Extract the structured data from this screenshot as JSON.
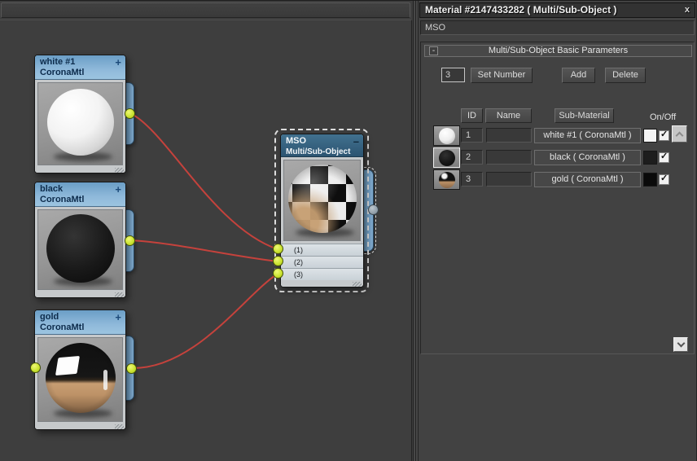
{
  "panel": {
    "title": "Material #2147433282 ( Multi/Sub-Object )",
    "close_glyph": "x",
    "material_name": "MSO"
  },
  "rollout": {
    "collapse_glyph": "-",
    "title": "Multi/Sub-Object Basic Parameters",
    "count_value": "3",
    "set_number_label": "Set Number",
    "add_label": "Add",
    "delete_label": "Delete"
  },
  "table": {
    "headers": {
      "id": "ID",
      "name": "Name",
      "sub_material": "Sub-Material",
      "on_off": "On/Off"
    },
    "check_glyph": "✓",
    "rows": [
      {
        "id": "1",
        "name": "",
        "sub_material": "white #1 ( CoronaMtl )",
        "swatch": "#f4f4f4",
        "on": true
      },
      {
        "id": "2",
        "name": "",
        "sub_material": "black ( CoronaMtl )",
        "swatch": "#1d1d1d",
        "on": true
      },
      {
        "id": "3",
        "name": "",
        "sub_material": "gold ( CoronaMtl )",
        "swatch": "#0a0a0a",
        "on": true
      }
    ]
  },
  "canvas": {
    "nodes": [
      {
        "title": "white #1",
        "subtitle": "CoronaMtl",
        "corner_glyph": "+"
      },
      {
        "title": "black",
        "subtitle": "CoronaMtl",
        "corner_glyph": "+"
      },
      {
        "title": "gold",
        "subtitle": "CoronaMtl",
        "corner_glyph": "+"
      },
      {
        "title": "MSO",
        "subtitle": "Multi/Sub-Object",
        "corner_glyph": "–",
        "slots": [
          "(1)",
          "(2)",
          "(3)"
        ]
      }
    ],
    "wire_color": "#c5423c",
    "socket_color": "#cbe332"
  }
}
